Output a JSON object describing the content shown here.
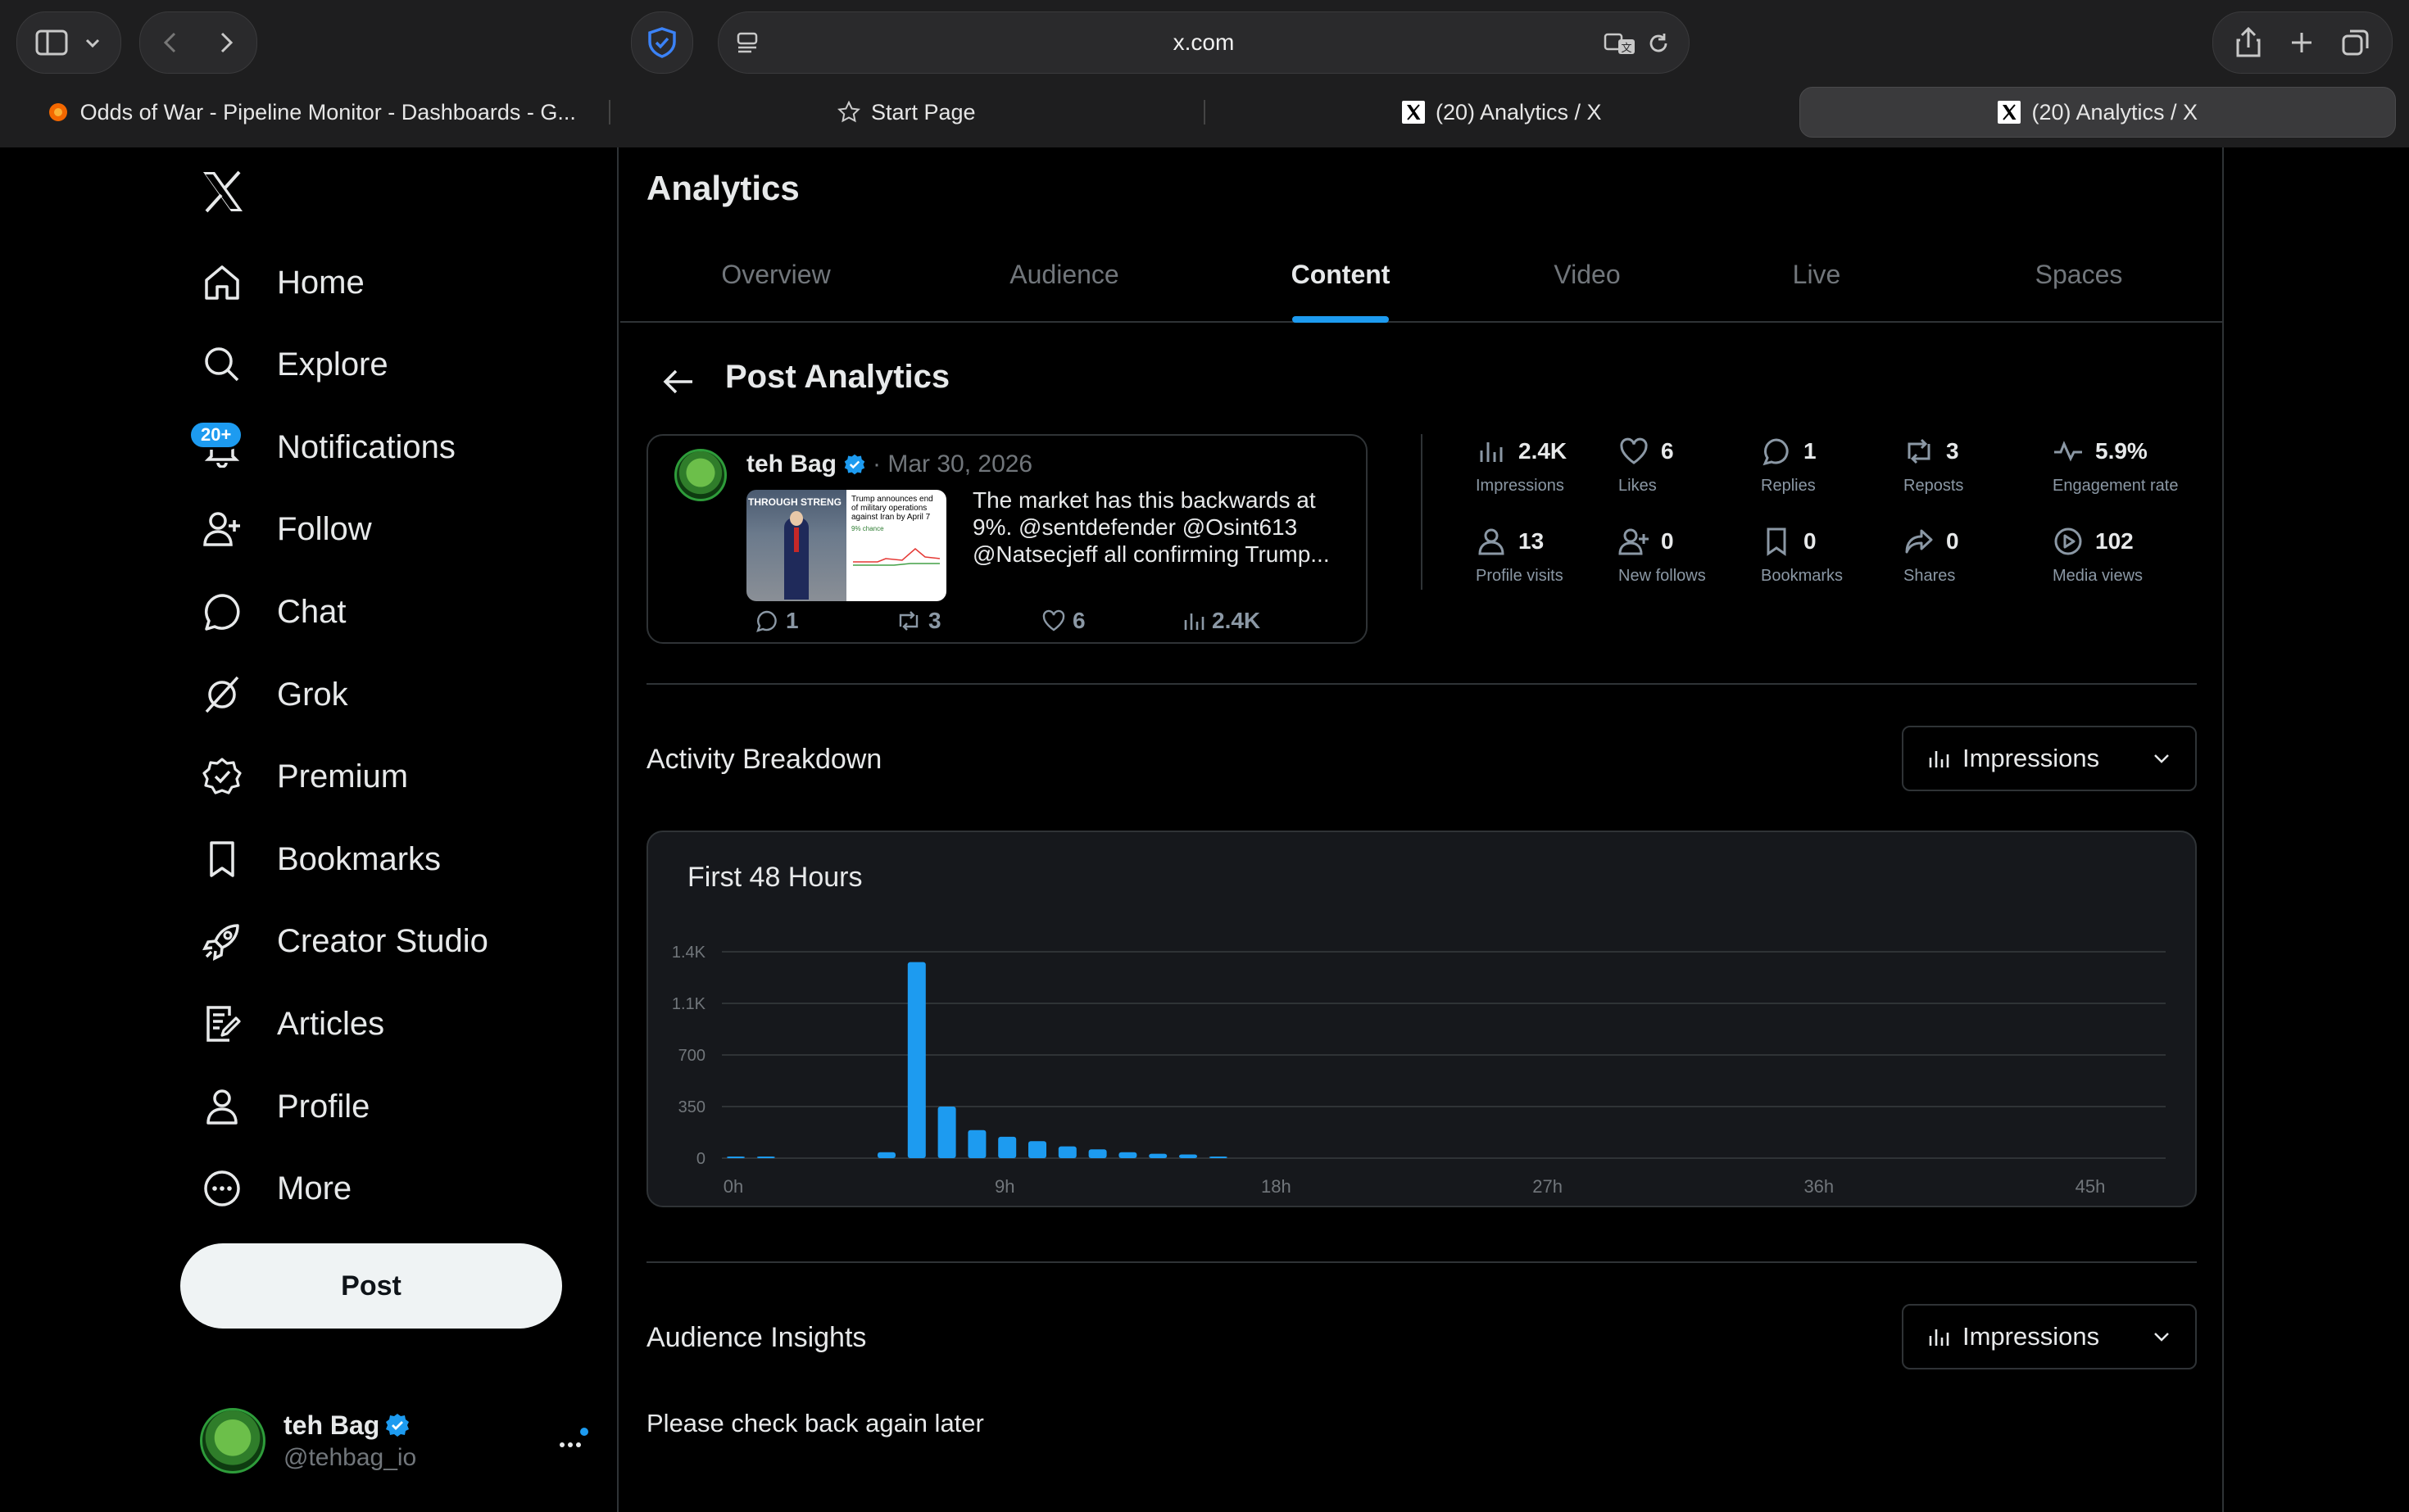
{
  "browser": {
    "url": "x.com",
    "tabs": [
      {
        "title": "Odds of War - Pipeline Monitor - Dashboards - G...",
        "icon": "grafana-icon"
      },
      {
        "title": "Start Page",
        "icon": "star-icon"
      },
      {
        "title": "(20) Analytics / X",
        "icon": "x-icon"
      },
      {
        "title": "(20) Analytics / X",
        "icon": "x-icon",
        "active": true
      }
    ]
  },
  "nav": {
    "items": [
      {
        "label": "Home",
        "icon": "home-icon"
      },
      {
        "label": "Explore",
        "icon": "search-icon"
      },
      {
        "label": "Notifications",
        "icon": "bell-icon",
        "badge": "20+"
      },
      {
        "label": "Follow",
        "icon": "add-person-icon"
      },
      {
        "label": "Chat",
        "icon": "chat-icon"
      },
      {
        "label": "Grok",
        "icon": "grok-icon"
      },
      {
        "label": "Premium",
        "icon": "verified-icon"
      },
      {
        "label": "Bookmarks",
        "icon": "bookmark-icon"
      },
      {
        "label": "Creator Studio",
        "icon": "rocket-icon"
      },
      {
        "label": "Articles",
        "icon": "article-icon"
      },
      {
        "label": "Profile",
        "icon": "person-icon"
      },
      {
        "label": "More",
        "icon": "more-circle-icon"
      }
    ],
    "post_label": "Post",
    "account": {
      "name": "teh Bag",
      "handle": "@tehbag_io"
    }
  },
  "main": {
    "title": "Analytics",
    "tabs": [
      "Overview",
      "Audience",
      "Content",
      "Video",
      "Live",
      "Spaces"
    ],
    "active_tab": "Content",
    "post_analytics_title": "Post Analytics",
    "post": {
      "author": "teh Bag",
      "date": "· Mar 30, 2026",
      "text_lines": [
        "The market has this backwards at",
        "9%. @sentdefender @Osint613",
        "@Natsecjeff all confirming Trump..."
      ],
      "thumb_texts": [
        "THROUGH STRENG",
        "Trump announces end",
        "of military operations",
        "against Iran by April 7",
        "9% chance"
      ],
      "replies": "1",
      "reposts": "3",
      "likes": "6",
      "views": "2.4K"
    },
    "stats": [
      {
        "value": "2.4K",
        "label": "Impressions",
        "icon": "bar-chart-icon"
      },
      {
        "value": "6",
        "label": "Likes",
        "icon": "heart-icon"
      },
      {
        "value": "1",
        "label": "Replies",
        "icon": "reply-icon"
      },
      {
        "value": "3",
        "label": "Reposts",
        "icon": "repost-icon"
      },
      {
        "value": "5.9%",
        "label": "Engagement rate",
        "icon": "pulse-icon"
      },
      {
        "value": "13",
        "label": "Profile visits",
        "icon": "person-icon"
      },
      {
        "value": "0",
        "label": "New follows",
        "icon": "add-person-icon"
      },
      {
        "value": "0",
        "label": "Bookmarks",
        "icon": "bookmark-icon"
      },
      {
        "value": "0",
        "label": "Shares",
        "icon": "share-icon"
      },
      {
        "value": "102",
        "label": "Media views",
        "icon": "play-icon"
      }
    ],
    "activity": {
      "title": "Activity Breakdown",
      "dropdown": "Impressions"
    },
    "insights": {
      "title": "Audience Insights",
      "dropdown": "Impressions",
      "message": "Please check back again later"
    }
  },
  "chart_data": {
    "type": "bar",
    "title": "First 48 Hours",
    "x_ticks": [
      "0h",
      "9h",
      "18h",
      "27h",
      "36h",
      "45h"
    ],
    "y_ticks": [
      "0",
      "350",
      "700",
      "1.1K",
      "1.4K"
    ],
    "ylim": [
      0,
      1400
    ],
    "x": [
      0,
      1,
      2,
      3,
      4,
      5,
      6,
      7,
      8,
      9,
      10,
      11,
      12,
      13,
      14,
      15,
      16,
      17,
      18,
      19,
      20,
      21,
      22,
      23,
      24,
      25,
      26,
      27,
      28,
      29,
      30,
      31,
      32,
      33,
      34,
      35,
      36,
      37,
      38,
      39,
      40,
      41,
      42,
      43,
      44,
      45,
      46,
      47
    ],
    "values": [
      5,
      5,
      0,
      0,
      0,
      40,
      1330,
      350,
      190,
      145,
      115,
      80,
      60,
      40,
      30,
      25,
      5,
      0,
      0,
      0,
      0,
      0,
      0,
      0,
      0,
      0,
      0,
      0,
      0,
      0,
      0,
      0,
      0,
      0,
      0,
      0,
      0,
      0,
      0,
      0,
      0,
      0,
      0,
      0,
      0,
      0,
      0,
      0
    ],
    "color": "#1d9bf0"
  }
}
